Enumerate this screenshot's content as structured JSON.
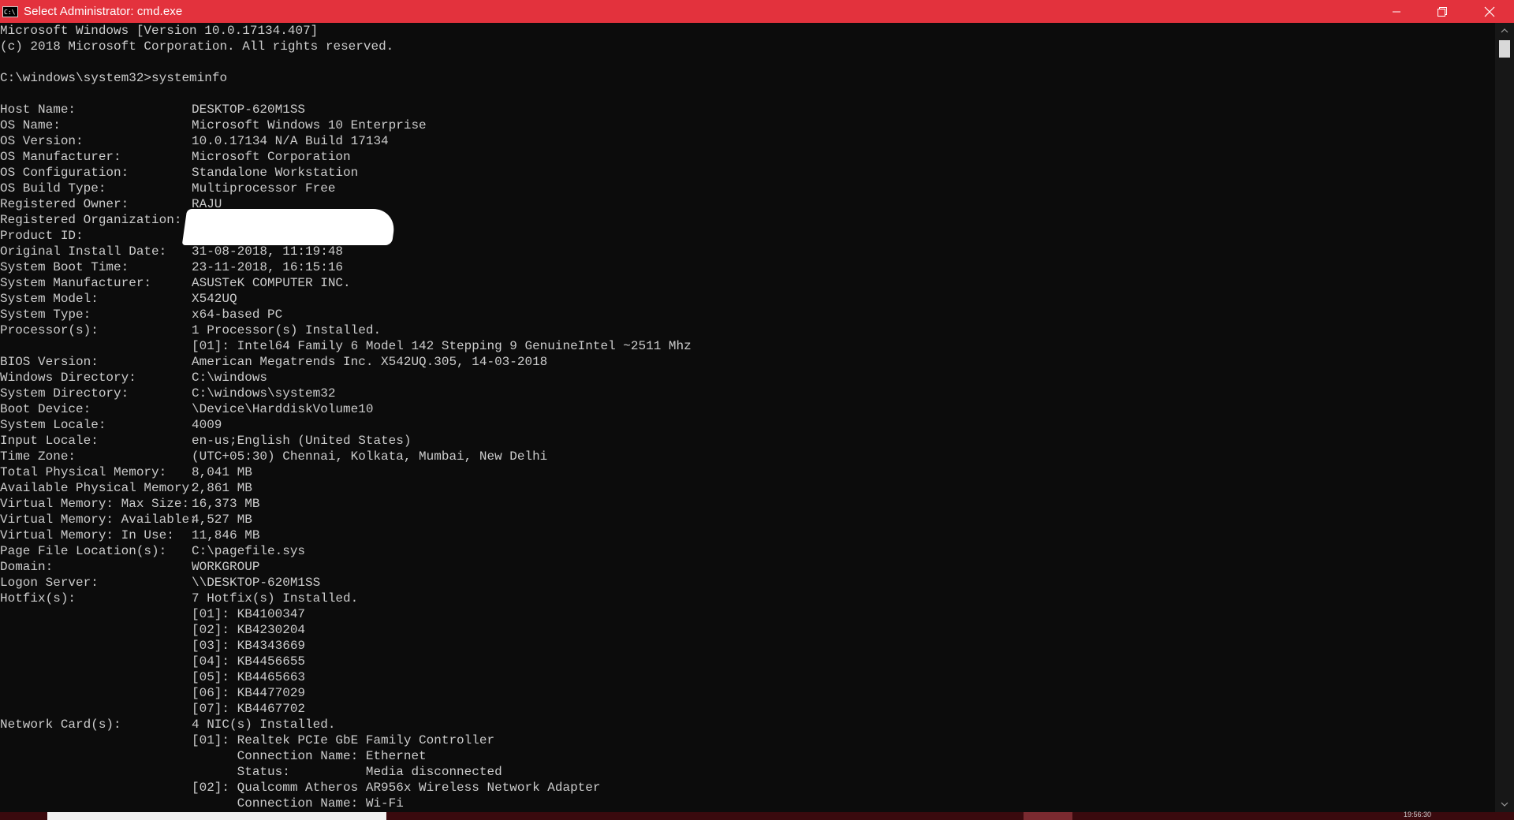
{
  "window": {
    "title": "Select Administrator: cmd.exe",
    "icon_text": "C:\\"
  },
  "console": {
    "header": [
      "Microsoft Windows [Version 10.0.17134.407]",
      "(c) 2018 Microsoft Corporation. All rights reserved.",
      "",
      "C:\\windows\\system32>systeminfo",
      ""
    ],
    "rows": [
      {
        "label": "Host Name:",
        "value": "DESKTOP-620M1SS"
      },
      {
        "label": "OS Name:",
        "value": "Microsoft Windows 10 Enterprise"
      },
      {
        "label": "OS Version:",
        "value": "10.0.17134 N/A Build 17134"
      },
      {
        "label": "OS Manufacturer:",
        "value": "Microsoft Corporation"
      },
      {
        "label": "OS Configuration:",
        "value": "Standalone Workstation"
      },
      {
        "label": "OS Build Type:",
        "value": "Multiprocessor Free"
      },
      {
        "label": "Registered Owner:",
        "value": "RAJU"
      },
      {
        "label": "Registered Organization:",
        "value": ""
      },
      {
        "label": "Product ID:",
        "value": ""
      },
      {
        "label": "Original Install Date:",
        "value": "31-08-2018, 11:19:48"
      },
      {
        "label": "System Boot Time:",
        "value": "23-11-2018, 16:15:16"
      },
      {
        "label": "System Manufacturer:",
        "value": "ASUSTeK COMPUTER INC."
      },
      {
        "label": "System Model:",
        "value": "X542UQ"
      },
      {
        "label": "System Type:",
        "value": "x64-based PC"
      },
      {
        "label": "Processor(s):",
        "value": "1 Processor(s) Installed."
      },
      {
        "label": "",
        "value": "[01]: Intel64 Family 6 Model 142 Stepping 9 GenuineIntel ~2511 Mhz"
      },
      {
        "label": "BIOS Version:",
        "value": "American Megatrends Inc. X542UQ.305, 14-03-2018"
      },
      {
        "label": "Windows Directory:",
        "value": "C:\\windows"
      },
      {
        "label": "System Directory:",
        "value": "C:\\windows\\system32"
      },
      {
        "label": "Boot Device:",
        "value": "\\Device\\HarddiskVolume10"
      },
      {
        "label": "System Locale:",
        "value": "4009"
      },
      {
        "label": "Input Locale:",
        "value": "en-us;English (United States)"
      },
      {
        "label": "Time Zone:",
        "value": "(UTC+05:30) Chennai, Kolkata, Mumbai, New Delhi"
      },
      {
        "label": "Total Physical Memory:",
        "value": "8,041 MB"
      },
      {
        "label": "Available Physical Memory:",
        "value": "2,861 MB"
      },
      {
        "label": "Virtual Memory: Max Size:",
        "value": "16,373 MB"
      },
      {
        "label": "Virtual Memory: Available:",
        "value": "4,527 MB"
      },
      {
        "label": "Virtual Memory: In Use:",
        "value": "11,846 MB"
      },
      {
        "label": "Page File Location(s):",
        "value": "C:\\pagefile.sys"
      },
      {
        "label": "Domain:",
        "value": "WORKGROUP"
      },
      {
        "label": "Logon Server:",
        "value": "\\\\DESKTOP-620M1SS"
      },
      {
        "label": "Hotfix(s):",
        "value": "7 Hotfix(s) Installed."
      },
      {
        "label": "",
        "value": "[01]: KB4100347"
      },
      {
        "label": "",
        "value": "[02]: KB4230204"
      },
      {
        "label": "",
        "value": "[03]: KB4343669"
      },
      {
        "label": "",
        "value": "[04]: KB4456655"
      },
      {
        "label": "",
        "value": "[05]: KB4465663"
      },
      {
        "label": "",
        "value": "[06]: KB4477029"
      },
      {
        "label": "",
        "value": "[07]: KB4467702"
      },
      {
        "label": "Network Card(s):",
        "value": "4 NIC(s) Installed."
      },
      {
        "label": "",
        "value": "[01]: Realtek PCIe GbE Family Controller"
      },
      {
        "label": "",
        "value": "      Connection Name: Ethernet"
      },
      {
        "label": "",
        "value": "      Status:          Media disconnected"
      },
      {
        "label": "",
        "value": "[02]: Qualcomm Atheros AR956x Wireless Network Adapter"
      },
      {
        "label": "",
        "value": "      Connection Name: Wi-Fi"
      }
    ]
  },
  "taskbar": {
    "clock": "19:56:30"
  }
}
